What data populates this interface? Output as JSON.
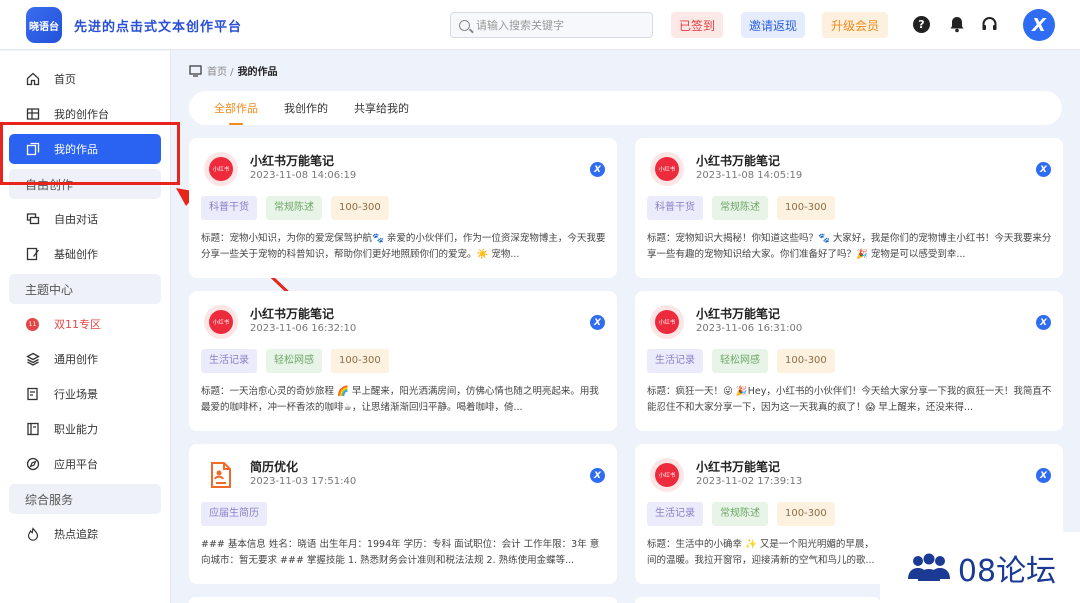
{
  "header": {
    "logo_text": "晓语台",
    "slogan": "先进的点击式文本创作平台",
    "search_placeholder": "请输入搜索关键字",
    "signed_label": "已签到",
    "invite_label": "邀请返现",
    "upgrade_label": "升级会员",
    "help_glyph": "?",
    "avatar_glyph": "X"
  },
  "sidebar": {
    "items": [
      {
        "label": "首页"
      },
      {
        "label": "我的创作台"
      },
      {
        "label": "我的作品"
      },
      {
        "label": "自由对话"
      },
      {
        "label": "基础创作"
      },
      {
        "label": "双11专区"
      },
      {
        "label": "通用创作"
      },
      {
        "label": "行业场景"
      },
      {
        "label": "职业能力"
      },
      {
        "label": "应用平台"
      },
      {
        "label": "热点追踪"
      }
    ],
    "sections": [
      "自由创作",
      "主题中心",
      "综合服务"
    ],
    "promo_icon_text": "11"
  },
  "breadcrumb": {
    "home": "首页 /",
    "current": "我的作品"
  },
  "tabs": [
    "全部作品",
    "我创作的",
    "共享给我的"
  ],
  "cards": [
    {
      "logo": "小红书",
      "title": "小红书万能笔记",
      "date": "2023-11-08 14:06:19",
      "tags": [
        "科普干货",
        "常规陈述",
        "100-300"
      ],
      "text": "标题：宠物小知识，为你的爱宠保驾护航🐾 亲爱的小伙伴们，作为一位资深宠物博主，今天我要分享一些关于宠物的科普知识，帮助你们更好地照顾你们的爱宠。☀️ 宠物..."
    },
    {
      "logo": "小红书",
      "title": "小红书万能笔记",
      "date": "2023-11-08 14:05:19",
      "tags": [
        "科普干货",
        "常规陈述",
        "100-300"
      ],
      "text": "标题：宠物知识大揭秘！你知道这些吗？🐾 大家好，我是你们的宠物博主小红书！今天我要来分享一些有趣的宠物知识给大家。你们准备好了吗？🎉 宠物是可以感受到幸..."
    },
    {
      "logo": "小红书",
      "title": "小红书万能笔记",
      "date": "2023-11-06 16:32:10",
      "tags": [
        "生活记录",
        "轻松网感",
        "100-300"
      ],
      "text": "标题：一天治愈心灵的奇妙旅程 🌈 早上醒来，阳光洒满房间，仿佛心情也随之明亮起来。用我最爱的咖啡杯，冲一杯香浓的咖啡☕，让思绪渐渐回归平静。喝着咖啡，倚..."
    },
    {
      "logo": "小红书",
      "title": "小红书万能笔记",
      "date": "2023-11-06 16:31:00",
      "tags": [
        "生活记录",
        "轻松网感",
        "100-300"
      ],
      "text": "标题：疯狂一天！😜 🎉Hey，小红书的小伙伴们！今天给大家分享一下我的疯狂一天！我简直不能忍住不和大家分享一下，因为这一天我真的疯了！😱 早上醒来，还没来得..."
    },
    {
      "logo": "resume",
      "title": "简历优化",
      "date": "2023-11-03 17:51:40",
      "tags": [
        "应届生简历"
      ],
      "text": "### 基本信息 姓名：晓语 出生年月：1994年 学历：专科 面试职位：会计 工作年限：3年 意向城市：暂无要求 ### 掌握技能 1. 熟悉财务会计准则和税法法规 2. 熟练使用金蝶等..."
    },
    {
      "logo": "小红书",
      "title": "小红书万能笔记",
      "date": "2023-11-02 17:39:13",
      "tags": [
        "生活记录",
        "常规陈述",
        "100-300"
      ],
      "text": "标题：生活中的小确幸 ✨ 又是一个阳光明媚的早晨，间的温暖。我拉开窗帘，迎接清新的空气和鸟儿的歌..."
    }
  ],
  "watermark": {
    "text": "08论坛"
  },
  "colors": {
    "accent": "#2a63f1",
    "annotation": "#e8241c",
    "tab_active": "#ef8a1c"
  }
}
